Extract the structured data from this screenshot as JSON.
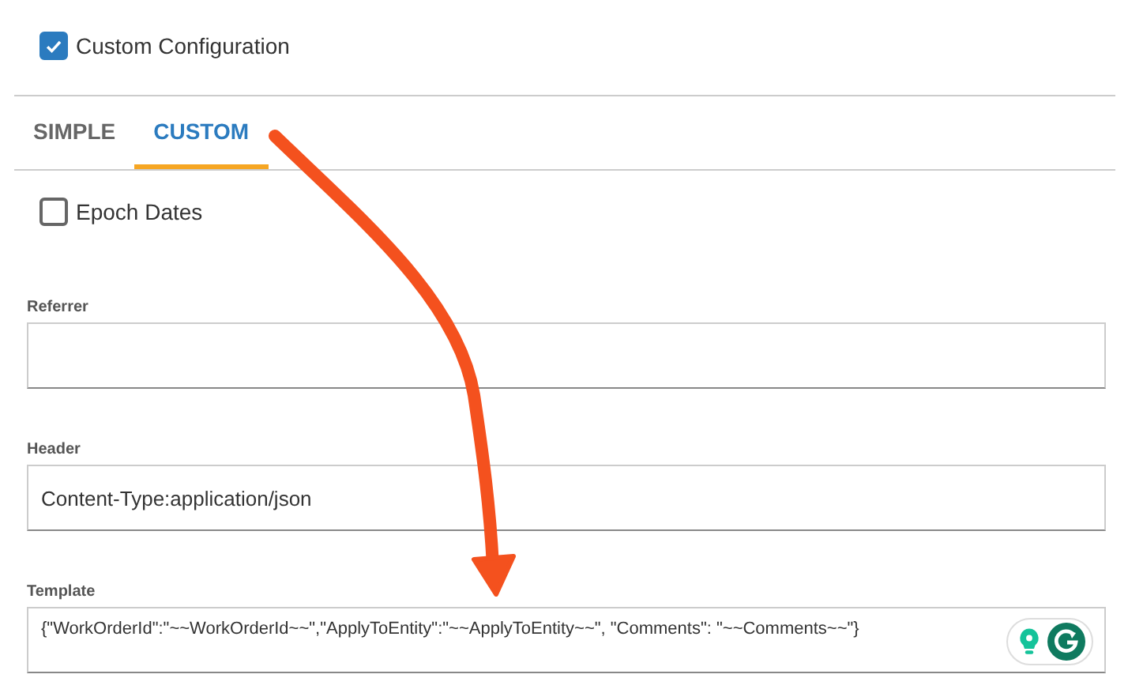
{
  "custom_configuration": {
    "label": "Custom Configuration",
    "checked": true
  },
  "tabs": [
    {
      "label": "SIMPLE",
      "selected": false
    },
    {
      "label": "CUSTOM",
      "selected": true
    }
  ],
  "epoch_dates": {
    "label": "Epoch Dates",
    "checked": false
  },
  "fields": [
    {
      "label": "Referrer"
    },
    {
      "label": "Header",
      "value": "Content-Type:application/json"
    },
    {
      "label": "Template",
      "value": "{\"WorkOrderId\":\"~~WorkOrderId~~\",\"ApplyToEntity\":\"~~ApplyToEntity~~\", \"Comments\": \"~~Comments~~\"}",
      "assistant": true
    }
  ]
}
